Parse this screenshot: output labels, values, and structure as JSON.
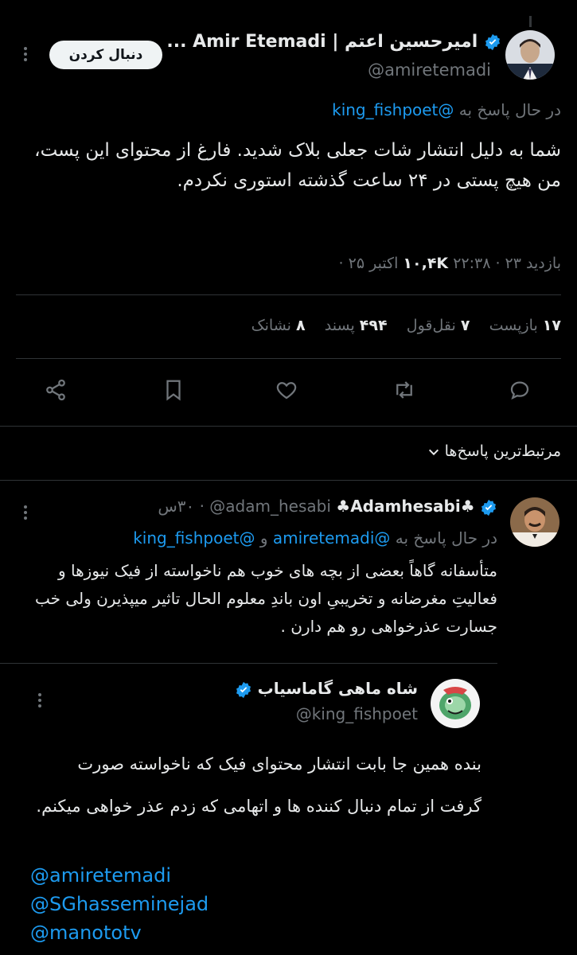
{
  "main_tweet": {
    "display_name": "امیرحسین اعتم | Amir Etemadi ...",
    "handle": "@amiretemadi",
    "follow_label": "دنبال کردن",
    "replying_prefix": "در حال پاسخ به",
    "replying_to": "@king_fishpoet",
    "text": "شما به دلیل انتشار شات جعلی بلاک شدید. فارغ از محتوای این پست، من هیچ پستی در ۲۴ ساعت گذشته استوری نکردم.",
    "meta_prefix": "بازدید",
    "views": "۱۰,۴K",
    "datetime": "۲۲:۳۸ · ۲۳ اکتبر ۲۵ ·",
    "stats": {
      "retweets_count": "۱۷",
      "retweets_label": "بازپست",
      "quotes_count": "۷",
      "quotes_label": "نقل‌قول",
      "likes_count": "۴۹۴",
      "likes_label": "پسند",
      "bookmarks_count": "۸",
      "bookmarks_label": "نشانک"
    }
  },
  "replies_header": {
    "label": "مرتبط‌ترین پاسخ‌ها"
  },
  "reply": {
    "display_name": "♣Adamhesabi♣",
    "handle": "@adam_hesabi",
    "time": "۳۰س",
    "replying_prefix": "در حال پاسخ به",
    "mention1": "@amiretemadi",
    "and_word": "و",
    "mention2": "@king_fishpoet",
    "text": "متأسفانه گاهاً بعضی از بچه های خوب هم ناخواسته از فیک نیوزها و فعالیتِ مغرضانه و تخریبیِ اون باندِ معلوم الحال تاثیر میپذیرن ولی خب جسارت عذرخواهی رو هم دارن ."
  },
  "quoted": {
    "display_name": "شاه ماهی گاماسیاب",
    "handle": "@king_fishpoet",
    "text": "بنده همین جا بابت انتشار محتوای فیک که ناخواسته صورت گرفت از تمام دنبال کننده ها و اتهامی که زدم عذر خواهی میکنم.",
    "mentions": [
      "@amiretemadi",
      "@SGhasseminejad",
      "@manototv"
    ]
  },
  "colors": {
    "accent": "#1d9bf0",
    "muted": "#71767b",
    "text": "#e7e9ea",
    "background": "#000000"
  }
}
